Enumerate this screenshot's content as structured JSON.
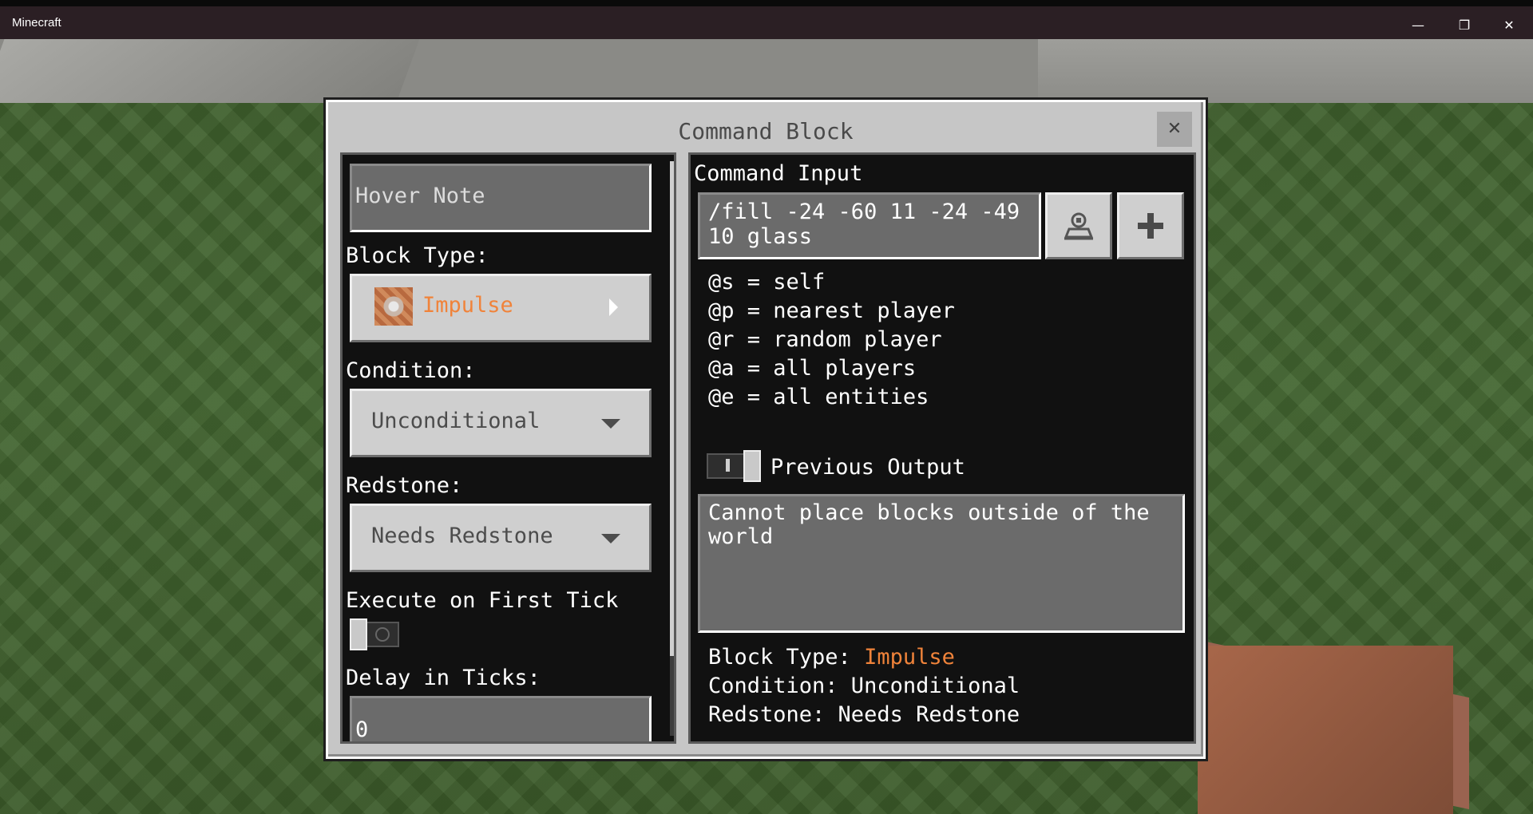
{
  "window": {
    "title": "Minecraft",
    "minimize": "—",
    "restore": "❐",
    "close": "✕"
  },
  "dialog": {
    "title": "Command Block",
    "close": "✕"
  },
  "left": {
    "hover_note_placeholder": "Hover Note",
    "block_type_label": "Block Type:",
    "block_type_value": "Impulse",
    "condition_label": "Condition:",
    "condition_value": "Unconditional",
    "redstone_label": "Redstone:",
    "redstone_value": "Needs Redstone",
    "execute_first_tick_label": "Execute on First Tick",
    "execute_first_tick_on": false,
    "delay_label": "Delay in Ticks:",
    "delay_value": "0"
  },
  "right": {
    "command_input_label": "Command Input",
    "command_value": "/fill -24 -60 11 -24 -49\n10 glass",
    "selectors": [
      "@s = self",
      "@p = nearest player",
      "@r = random player",
      "@a = all players",
      "@e = all entities"
    ],
    "previous_output_label": "Previous Output",
    "previous_output_on": true,
    "output_text": "Cannot place blocks outside of the\nworld",
    "summary": {
      "block_type_prefix": "Block Type: ",
      "block_type_value": "Impulse",
      "condition": "Condition: Unconditional",
      "redstone": "Redstone: Needs Redstone"
    },
    "icons": {
      "selector_button": "entity-selector-icon",
      "add_button": "plus-icon"
    }
  },
  "colors": {
    "accent_orange": "#f0833a",
    "panel": "#111111",
    "dialog": "#c6c6c6"
  }
}
